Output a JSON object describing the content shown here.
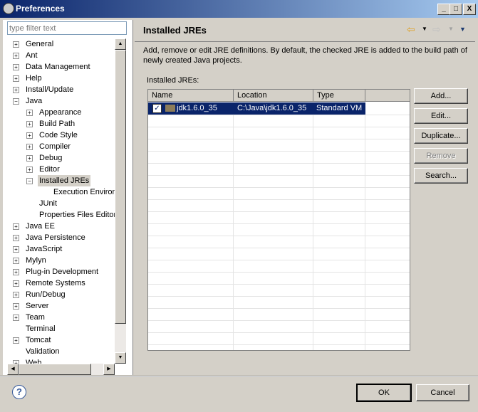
{
  "window": {
    "title": "Preferences",
    "min": "_",
    "max": "□",
    "close": "X"
  },
  "filter": {
    "placeholder": "type filter text"
  },
  "tree": [
    {
      "label": "General",
      "level": 0,
      "exp": "+"
    },
    {
      "label": "Ant",
      "level": 0,
      "exp": "+"
    },
    {
      "label": "Data Management",
      "level": 0,
      "exp": "+"
    },
    {
      "label": "Help",
      "level": 0,
      "exp": "+"
    },
    {
      "label": "Install/Update",
      "level": 0,
      "exp": "+"
    },
    {
      "label": "Java",
      "level": 0,
      "exp": "-"
    },
    {
      "label": "Appearance",
      "level": 1,
      "exp": "+"
    },
    {
      "label": "Build Path",
      "level": 1,
      "exp": "+"
    },
    {
      "label": "Code Style",
      "level": 1,
      "exp": "+"
    },
    {
      "label": "Compiler",
      "level": 1,
      "exp": "+"
    },
    {
      "label": "Debug",
      "level": 1,
      "exp": "+"
    },
    {
      "label": "Editor",
      "level": 1,
      "exp": "+"
    },
    {
      "label": "Installed JREs",
      "level": 1,
      "exp": "-",
      "selected": true
    },
    {
      "label": "Execution Environments",
      "level": 2,
      "exp": ""
    },
    {
      "label": "JUnit",
      "level": 1,
      "exp": ""
    },
    {
      "label": "Properties Files Editor",
      "level": 1,
      "exp": ""
    },
    {
      "label": "Java EE",
      "level": 0,
      "exp": "+"
    },
    {
      "label": "Java Persistence",
      "level": 0,
      "exp": "+"
    },
    {
      "label": "JavaScript",
      "level": 0,
      "exp": "+"
    },
    {
      "label": "Mylyn",
      "level": 0,
      "exp": "+"
    },
    {
      "label": "Plug-in Development",
      "level": 0,
      "exp": "+"
    },
    {
      "label": "Remote Systems",
      "level": 0,
      "exp": "+"
    },
    {
      "label": "Run/Debug",
      "level": 0,
      "exp": "+"
    },
    {
      "label": "Server",
      "level": 0,
      "exp": "+"
    },
    {
      "label": "Team",
      "level": 0,
      "exp": "+"
    },
    {
      "label": "Terminal",
      "level": 0,
      "exp": ""
    },
    {
      "label": "Tomcat",
      "level": 0,
      "exp": "+"
    },
    {
      "label": "Validation",
      "level": 0,
      "exp": ""
    },
    {
      "label": "Web",
      "level": 0,
      "exp": "+"
    }
  ],
  "page": {
    "title": "Installed JREs",
    "description": "Add, remove or edit JRE definitions. By default, the checked JRE is added to the build path of newly created Java projects.",
    "list_label": "Installed JREs:"
  },
  "table": {
    "columns": [
      "Name",
      "Location",
      "Type"
    ],
    "rows": [
      {
        "name": "jdk1.6.0_35",
        "location": "C:\\Java\\jdk1.6.0_35",
        "type": "Standard VM",
        "checked": true
      }
    ]
  },
  "buttons": {
    "add": "Add...",
    "edit": "Edit...",
    "duplicate": "Duplicate...",
    "remove": "Remove",
    "search": "Search...",
    "ok": "OK",
    "cancel": "Cancel",
    "help": "?"
  }
}
